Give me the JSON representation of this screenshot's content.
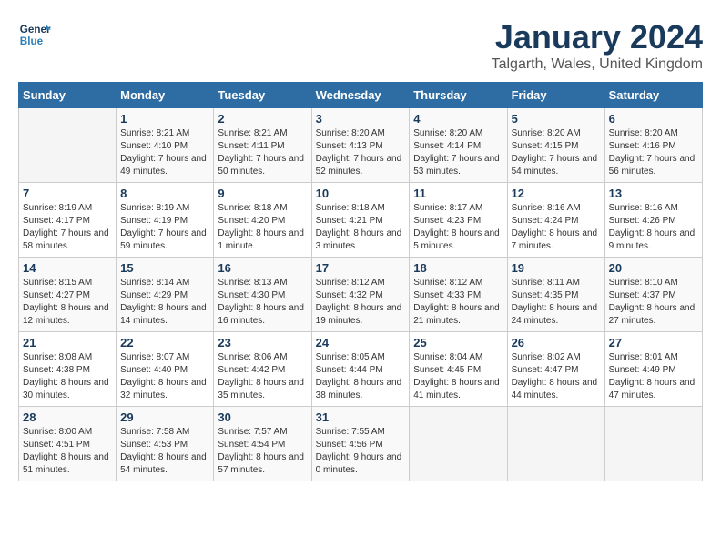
{
  "logo": {
    "line1": "General",
    "line2": "Blue"
  },
  "title": "January 2024",
  "location": "Talgarth, Wales, United Kingdom",
  "days_header": [
    "Sunday",
    "Monday",
    "Tuesday",
    "Wednesday",
    "Thursday",
    "Friday",
    "Saturday"
  ],
  "weeks": [
    [
      {
        "num": "",
        "info": ""
      },
      {
        "num": "1",
        "info": "Sunrise: 8:21 AM\nSunset: 4:10 PM\nDaylight: 7 hours\nand 49 minutes."
      },
      {
        "num": "2",
        "info": "Sunrise: 8:21 AM\nSunset: 4:11 PM\nDaylight: 7 hours\nand 50 minutes."
      },
      {
        "num": "3",
        "info": "Sunrise: 8:20 AM\nSunset: 4:13 PM\nDaylight: 7 hours\nand 52 minutes."
      },
      {
        "num": "4",
        "info": "Sunrise: 8:20 AM\nSunset: 4:14 PM\nDaylight: 7 hours\nand 53 minutes."
      },
      {
        "num": "5",
        "info": "Sunrise: 8:20 AM\nSunset: 4:15 PM\nDaylight: 7 hours\nand 54 minutes."
      },
      {
        "num": "6",
        "info": "Sunrise: 8:20 AM\nSunset: 4:16 PM\nDaylight: 7 hours\nand 56 minutes."
      }
    ],
    [
      {
        "num": "7",
        "info": "Sunrise: 8:19 AM\nSunset: 4:17 PM\nDaylight: 7 hours\nand 58 minutes."
      },
      {
        "num": "8",
        "info": "Sunrise: 8:19 AM\nSunset: 4:19 PM\nDaylight: 7 hours\nand 59 minutes."
      },
      {
        "num": "9",
        "info": "Sunrise: 8:18 AM\nSunset: 4:20 PM\nDaylight: 8 hours\nand 1 minute."
      },
      {
        "num": "10",
        "info": "Sunrise: 8:18 AM\nSunset: 4:21 PM\nDaylight: 8 hours\nand 3 minutes."
      },
      {
        "num": "11",
        "info": "Sunrise: 8:17 AM\nSunset: 4:23 PM\nDaylight: 8 hours\nand 5 minutes."
      },
      {
        "num": "12",
        "info": "Sunrise: 8:16 AM\nSunset: 4:24 PM\nDaylight: 8 hours\nand 7 minutes."
      },
      {
        "num": "13",
        "info": "Sunrise: 8:16 AM\nSunset: 4:26 PM\nDaylight: 8 hours\nand 9 minutes."
      }
    ],
    [
      {
        "num": "14",
        "info": "Sunrise: 8:15 AM\nSunset: 4:27 PM\nDaylight: 8 hours\nand 12 minutes."
      },
      {
        "num": "15",
        "info": "Sunrise: 8:14 AM\nSunset: 4:29 PM\nDaylight: 8 hours\nand 14 minutes."
      },
      {
        "num": "16",
        "info": "Sunrise: 8:13 AM\nSunset: 4:30 PM\nDaylight: 8 hours\nand 16 minutes."
      },
      {
        "num": "17",
        "info": "Sunrise: 8:12 AM\nSunset: 4:32 PM\nDaylight: 8 hours\nand 19 minutes."
      },
      {
        "num": "18",
        "info": "Sunrise: 8:12 AM\nSunset: 4:33 PM\nDaylight: 8 hours\nand 21 minutes."
      },
      {
        "num": "19",
        "info": "Sunrise: 8:11 AM\nSunset: 4:35 PM\nDaylight: 8 hours\nand 24 minutes."
      },
      {
        "num": "20",
        "info": "Sunrise: 8:10 AM\nSunset: 4:37 PM\nDaylight: 8 hours\nand 27 minutes."
      }
    ],
    [
      {
        "num": "21",
        "info": "Sunrise: 8:08 AM\nSunset: 4:38 PM\nDaylight: 8 hours\nand 30 minutes."
      },
      {
        "num": "22",
        "info": "Sunrise: 8:07 AM\nSunset: 4:40 PM\nDaylight: 8 hours\nand 32 minutes."
      },
      {
        "num": "23",
        "info": "Sunrise: 8:06 AM\nSunset: 4:42 PM\nDaylight: 8 hours\nand 35 minutes."
      },
      {
        "num": "24",
        "info": "Sunrise: 8:05 AM\nSunset: 4:44 PM\nDaylight: 8 hours\nand 38 minutes."
      },
      {
        "num": "25",
        "info": "Sunrise: 8:04 AM\nSunset: 4:45 PM\nDaylight: 8 hours\nand 41 minutes."
      },
      {
        "num": "26",
        "info": "Sunrise: 8:02 AM\nSunset: 4:47 PM\nDaylight: 8 hours\nand 44 minutes."
      },
      {
        "num": "27",
        "info": "Sunrise: 8:01 AM\nSunset: 4:49 PM\nDaylight: 8 hours\nand 47 minutes."
      }
    ],
    [
      {
        "num": "28",
        "info": "Sunrise: 8:00 AM\nSunset: 4:51 PM\nDaylight: 8 hours\nand 51 minutes."
      },
      {
        "num": "29",
        "info": "Sunrise: 7:58 AM\nSunset: 4:53 PM\nDaylight: 8 hours\nand 54 minutes."
      },
      {
        "num": "30",
        "info": "Sunrise: 7:57 AM\nSunset: 4:54 PM\nDaylight: 8 hours\nand 57 minutes."
      },
      {
        "num": "31",
        "info": "Sunrise: 7:55 AM\nSunset: 4:56 PM\nDaylight: 9 hours\nand 0 minutes."
      },
      {
        "num": "",
        "info": ""
      },
      {
        "num": "",
        "info": ""
      },
      {
        "num": "",
        "info": ""
      }
    ]
  ]
}
